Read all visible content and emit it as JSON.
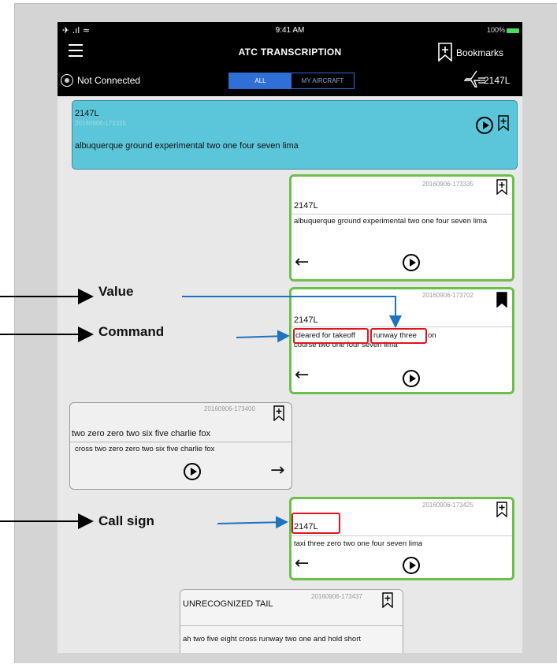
{
  "status": {
    "signal": "✈ .ıl ≈",
    "time": "9:41 AM",
    "battery": "100%"
  },
  "header": {
    "title": "ATC TRANSCRIPTION",
    "bookmarks_label": "Bookmarks"
  },
  "subheader": {
    "connection": "Not Connected",
    "tabs": [
      "ALL",
      "MY AIRCRAFT"
    ],
    "aircraft": "2147L"
  },
  "messages": [
    {
      "callsign": "2147L",
      "timestamp": "20160906-173335",
      "text": "albuquerque ground experimental two one four seven lima"
    },
    {
      "callsign": "2147L",
      "timestamp": "20160906-173335",
      "text": "albuquerque ground experimental two one four seven lima"
    },
    {
      "callsign": "2147L",
      "timestamp": "20160906-173702",
      "text_parts": [
        "cleared for takeoff",
        "runway three",
        "on course two one four seven lima"
      ]
    },
    {
      "callsign": "two zero zero two six five charlie fox",
      "timestamp": "20160906-173400",
      "text": "cross two zero zero two six five charlie fox"
    },
    {
      "callsign": "2147L",
      "timestamp": "20160906-173425",
      "text": "taxi three zero two one four seven lima"
    },
    {
      "callsign": "UNRECOGNIZED TAIL",
      "timestamp": "20160906-173437",
      "text": "ah two five eight cross runway two one and hold short"
    }
  ],
  "annotations": {
    "value": "Value",
    "command": "Command",
    "callsign": "Call sign"
  },
  "colors": {
    "selected_card": "#5bc6d9",
    "highlight_border": "#6cc04a",
    "annotation_box": "#e0141e",
    "annotation_arrow": "#1e73be"
  }
}
